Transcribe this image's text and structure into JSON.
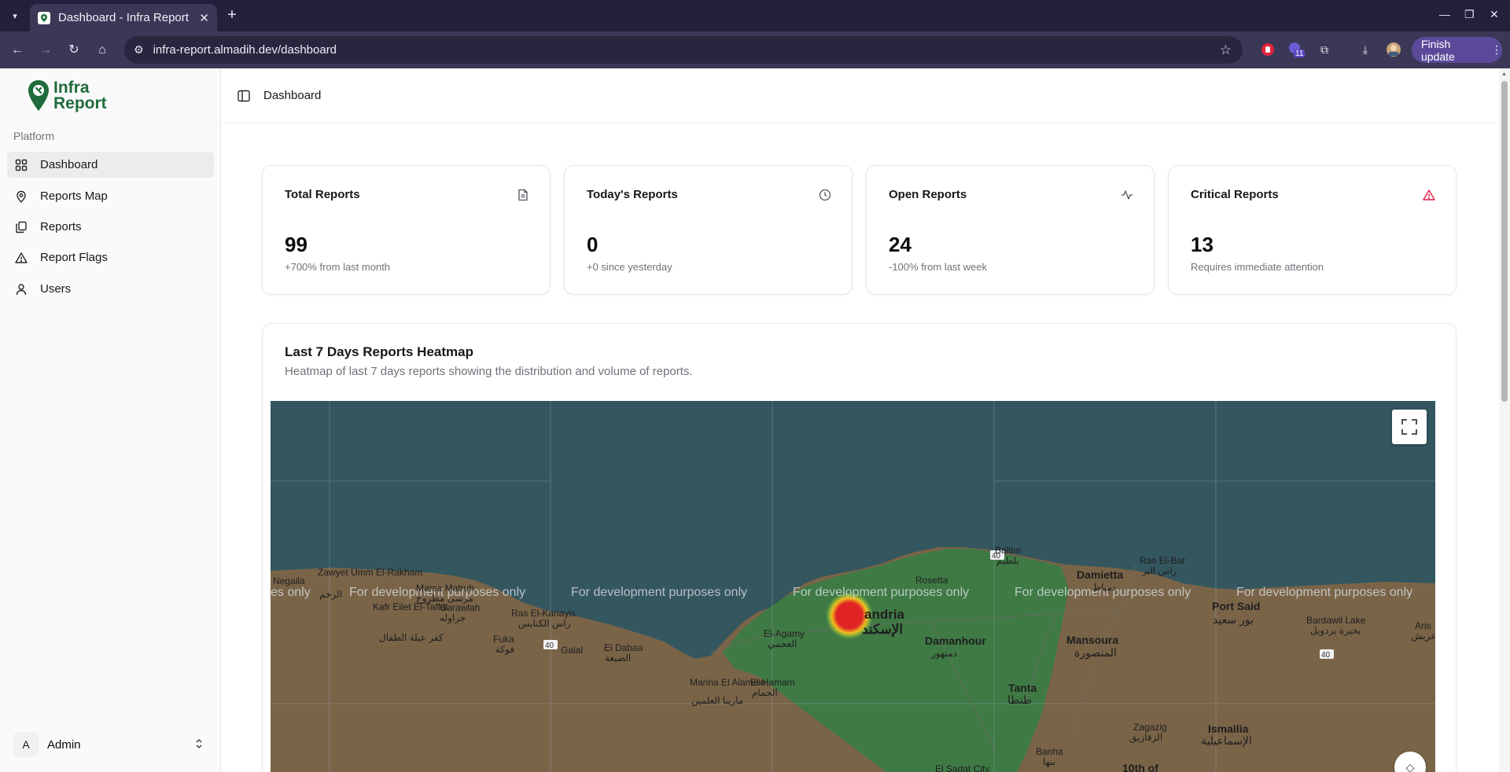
{
  "browser": {
    "tab_title": "Dashboard - Infra Report",
    "url": "infra-report.almadih.dev/dashboard",
    "extension_badge": "11",
    "finish_update_label": "Finish update"
  },
  "sidebar": {
    "logo_line1": "Infra",
    "logo_line2": "Report",
    "section_label": "Platform",
    "items": [
      {
        "label": "Dashboard",
        "icon": "grid-icon"
      },
      {
        "label": "Reports Map",
        "icon": "map-pin-icon"
      },
      {
        "label": "Reports",
        "icon": "files-icon"
      },
      {
        "label": "Report Flags",
        "icon": "warning-icon"
      },
      {
        "label": "Users",
        "icon": "user-icon"
      }
    ],
    "user": {
      "initial": "A",
      "name": "Admin"
    }
  },
  "header": {
    "breadcrumb": "Dashboard"
  },
  "stats": [
    {
      "title": "Total Reports",
      "value": "99",
      "sub": "+700% from last month",
      "icon": "document-icon"
    },
    {
      "title": "Today's Reports",
      "value": "0",
      "sub": "+0 since yesterday",
      "icon": "clock-icon"
    },
    {
      "title": "Open Reports",
      "value": "24",
      "sub": "-100% from last week",
      "icon": "activity-icon"
    },
    {
      "title": "Critical Reports",
      "value": "13",
      "sub": "Requires immediate attention",
      "icon": "alert-triangle-icon",
      "color": "#e11d48"
    }
  ],
  "heatmap": {
    "title": "Last 7 Days Reports Heatmap",
    "subtitle": "Heatmap of last 7 days reports showing the distribution and volume of reports.",
    "watermark": "For development purposes only",
    "watermark_partial": "es only",
    "places": [
      "Negaila",
      "Zawyet Umm El-Rakham",
      "الرخم",
      "Marsa Matruh",
      "مرسى مطروح",
      "Garawlah",
      "جراوله",
      "Kafr Eilet El-Taffal",
      "كفر عيلة الطفال",
      "Ras El-Kanayis",
      "راس الكنايس",
      "Fuka",
      "فوكة",
      "Galal",
      "El Dabaa",
      "الضبعة",
      "Marina El Alamein",
      "مارينا العلمين",
      "El-Hamam",
      "الحمام",
      "El-Agamy",
      "العجمي",
      "andria",
      "الإسكند",
      "Rosetta",
      "Damanhour",
      "دمنهور",
      "Baltim",
      "بلطيم",
      "Damietta",
      "دمياط",
      "Ras El-Bar",
      "راس البر",
      "Mansoura",
      "المنصورة",
      "Port Said",
      "بور سعيد",
      "Bardawil Lake",
      "بحيرة بردويل",
      "Aris",
      "عريش",
      "Tanta",
      "طنطا",
      "Zagazig",
      "الزقازيق",
      "Ismailia",
      "الإسماعيلية",
      "Banha",
      "بنها",
      "El Sadat City",
      "10th of"
    ],
    "road_number": "40",
    "colors": {
      "sea": "#34565f",
      "land": "#7a6448",
      "green": "#3f7a45",
      "hotspot": "#e02424"
    }
  }
}
